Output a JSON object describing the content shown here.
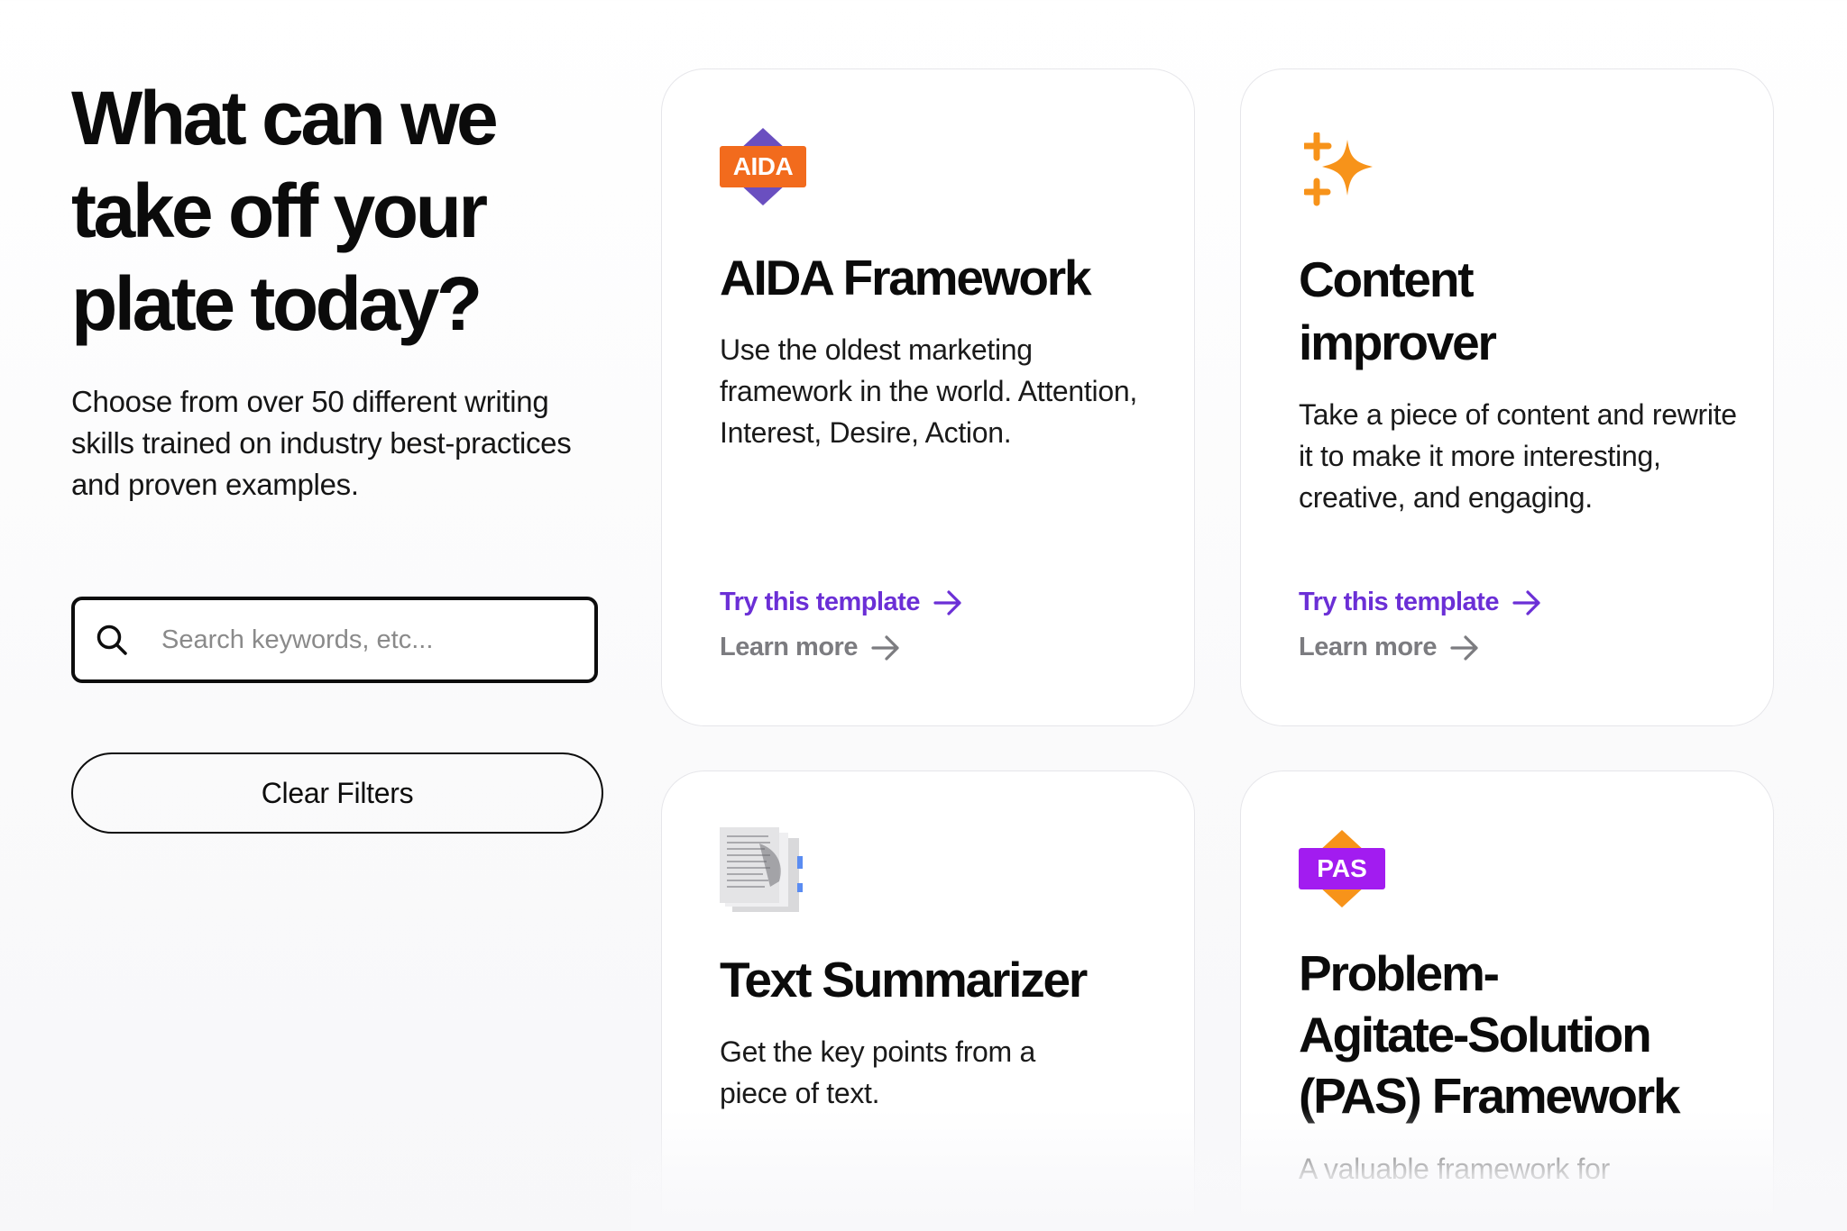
{
  "hero": {
    "headline_line1": "What can we",
    "headline_line2": "take off your",
    "headline_line3": "plate today?",
    "subtext": "Choose from over 50 different writing skills trained on industry best-practices and proven examples."
  },
  "search": {
    "placeholder": "Search keywords, etc..."
  },
  "filters": {
    "clear_label": "Clear Filters"
  },
  "cards": [
    {
      "badge": "AIDA",
      "title": "AIDA Framework",
      "description": "Use the oldest marketing framework in the world. Attention, Interest, Desire, Action.",
      "try_label": "Try this template",
      "learn_label": "Learn more"
    },
    {
      "title_line1": "Content",
      "title_line2": "improver",
      "description": "Take a piece of content and rewrite it to make it more interesting, creative, and engaging.",
      "try_label": "Try this template",
      "learn_label": "Learn more"
    },
    {
      "title": "Text Summarizer",
      "description": "Get the key points from a piece of text."
    },
    {
      "badge": "PAS",
      "title_line1": "Problem-",
      "title_line2": "Agitate-Solution",
      "title_line3": "(PAS) Framework",
      "description": "A valuable framework for"
    }
  ],
  "colors": {
    "accent": "#6b2fd6",
    "muted_link": "#7c7c80",
    "aida_orange": "#f26b1d",
    "aida_purple": "#6a4fc0",
    "sparkle_orange": "#f7931a",
    "pas_purple": "#a21cf0",
    "pas_orange": "#f7931a"
  }
}
